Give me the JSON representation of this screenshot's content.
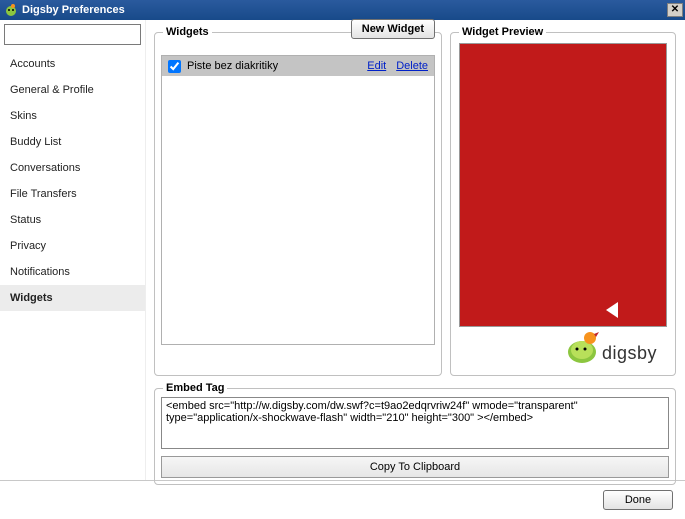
{
  "window": {
    "title": "Digsby Preferences"
  },
  "search": {
    "placeholder": ""
  },
  "sidebar": {
    "items": [
      {
        "label": "Accounts"
      },
      {
        "label": "General & Profile"
      },
      {
        "label": "Skins"
      },
      {
        "label": "Buddy List"
      },
      {
        "label": "Conversations"
      },
      {
        "label": "File Transfers"
      },
      {
        "label": "Status"
      },
      {
        "label": "Privacy"
      },
      {
        "label": "Notifications"
      },
      {
        "label": "Widgets"
      }
    ],
    "activeIndex": 9
  },
  "widgets": {
    "legend": "Widgets",
    "newButton": "New Widget",
    "items": [
      {
        "checked": true,
        "title": "Piste bez diakritiky",
        "edit": "Edit",
        "delete": "Delete"
      }
    ]
  },
  "preview": {
    "legend": "Widget Preview",
    "logoText": "digsby",
    "bgColor": "#c11a1a"
  },
  "embed": {
    "legend": "Embed Tag",
    "text": "<embed src=\"http://w.digsby.com/dw.swf?c=t9ao2edqrvriw24f\" wmode=\"transparent\" type=\"application/x-shockwave-flash\" width=\"210\" height=\"300\" ></embed>",
    "copy": "Copy To Clipboard"
  },
  "footer": {
    "done": "Done"
  }
}
